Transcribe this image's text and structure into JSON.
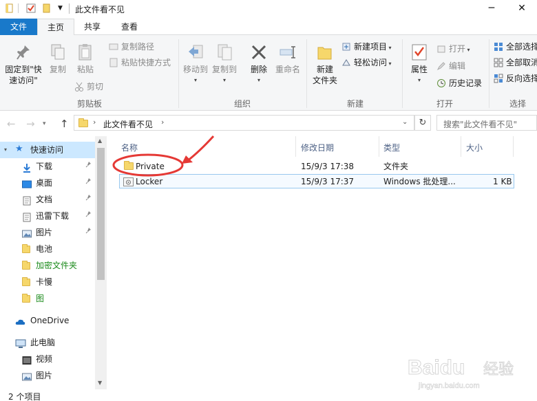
{
  "window": {
    "title": "此文件看不见",
    "minimize": "─",
    "close": "✕"
  },
  "tabs": {
    "file": "文件",
    "home": "主页",
    "share": "共享",
    "view": "查看"
  },
  "ribbon": {
    "pin_quick_access": "固定到\"快",
    "pin_quick_access_2": "速访问\"",
    "copy": "复制",
    "paste": "粘贴",
    "copy_path": "复制路径",
    "paste_shortcut": "粘贴快捷方式",
    "cut": "剪切",
    "group_clipboard": "剪贴板",
    "move_to": "移动到",
    "copy_to": "复制到",
    "delete": "删除",
    "rename": "重命名",
    "group_organize": "组织",
    "new_folder": "新建",
    "new_folder_2": "文件夹",
    "new_item": "新建项目",
    "easy_access": "轻松访问",
    "group_new": "新建",
    "properties": "属性",
    "open": "打开",
    "edit": "编辑",
    "history": "历史记录",
    "group_open": "打开",
    "select_all": "全部选择",
    "select_none": "全部取消",
    "invert_selection": "反向选择",
    "group_select": "选择"
  },
  "address": {
    "path": "此文件看不见",
    "search_placeholder": "搜索\"此文件看不见\""
  },
  "sidebar": {
    "quick_access": "快速访问",
    "items": [
      {
        "label": "下载",
        "pinned": true
      },
      {
        "label": "桌面",
        "pinned": true
      },
      {
        "label": "文档",
        "pinned": true
      },
      {
        "label": "迅雷下载",
        "pinned": true
      },
      {
        "label": "图片",
        "pinned": true
      },
      {
        "label": "电池",
        "pinned": false
      },
      {
        "label": "加密文件夹",
        "pinned": false
      },
      {
        "label": "卡慢",
        "pinned": false
      },
      {
        "label": "图",
        "pinned": false
      }
    ],
    "onedrive": "OneDrive",
    "this_pc": "此电脑",
    "pc_items": [
      "视频",
      "图片"
    ]
  },
  "file_list": {
    "columns": [
      "名称",
      "修改日期",
      "类型",
      "大小"
    ],
    "rows": [
      {
        "name": "Private",
        "modified": "15/9/3 17:38",
        "type": "文件夹",
        "size": ""
      },
      {
        "name": "Locker",
        "modified": "15/9/3 17:37",
        "type": "Windows 批处理...",
        "size": "1 KB"
      }
    ]
  },
  "status": {
    "count": "2 个项目"
  },
  "watermark": {
    "brand": "Baidu",
    "brand_suffix": "经验",
    "url": "jingyan.baidu.com"
  },
  "colors": {
    "accent": "#1979ca",
    "folder": "#f6d76b",
    "annotation_red": "#e53935",
    "green_label": "#1a8a1a"
  }
}
